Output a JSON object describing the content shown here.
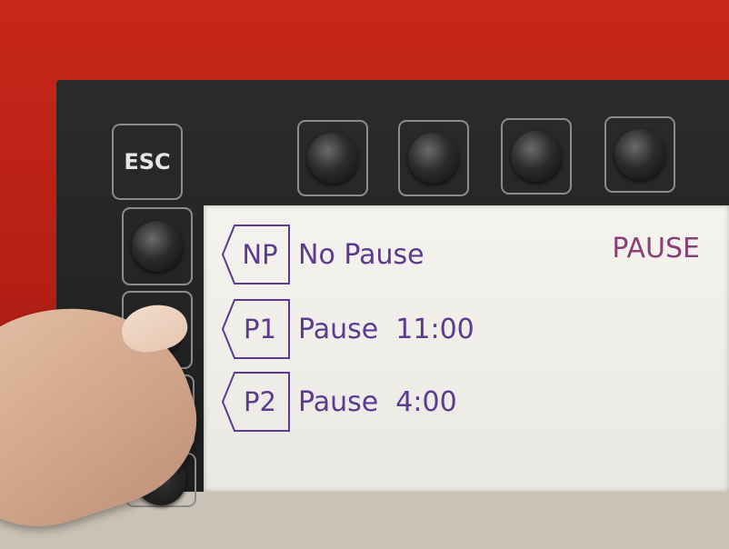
{
  "panel": {
    "esc_label": "ESC"
  },
  "screen": {
    "status": "PAUSE",
    "items": [
      {
        "code": "NP",
        "label": "No Pause"
      },
      {
        "code": "P1",
        "label": "Pause  11:00"
      },
      {
        "code": "P2",
        "label": "Pause  4:00"
      }
    ]
  },
  "colors": {
    "housing": "#b31f14",
    "bezel": "#222325",
    "screen_bg": "#f1f0eb",
    "lcd_text": "#5b3a8f",
    "status_text": "#8a3f77"
  }
}
